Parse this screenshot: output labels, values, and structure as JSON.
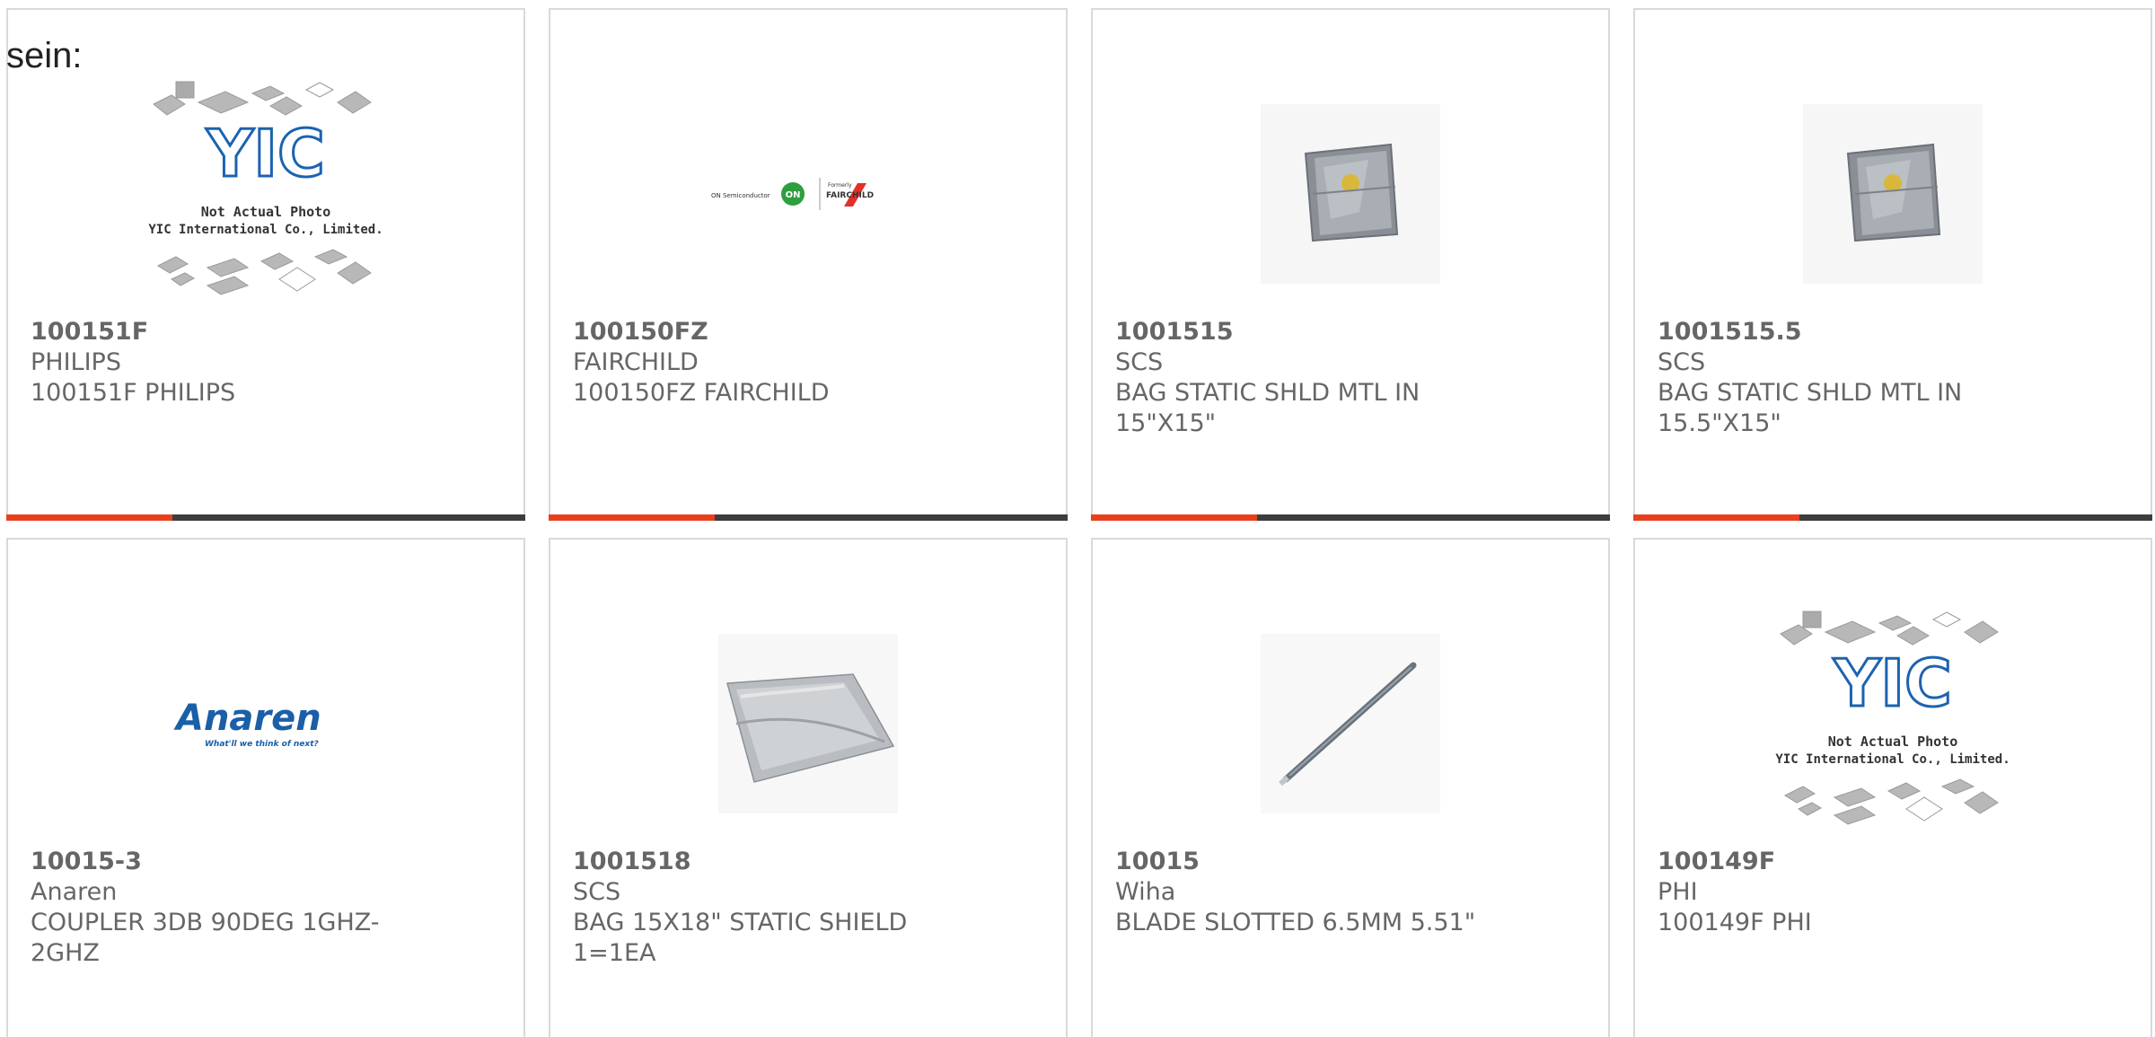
{
  "prefix_text": "sein:",
  "colors": {
    "text": "#666666",
    "border": "#d9d9d9",
    "bar": "#3d3d3d",
    "bar_accent": "#e8401c"
  },
  "products": [
    {
      "part_number": "100151F",
      "manufacturer": "PHILIPS",
      "description": "100151F PHILIPS",
      "image": "yic-placeholder-image",
      "image_text": {
        "line1": "Not Actual Photo",
        "line2": "YIC International Co., Limited.",
        "logo": "YIC"
      }
    },
    {
      "part_number": "100150FZ",
      "manufacturer": "FAIRCHILD",
      "description": "100150FZ FAIRCHILD",
      "image": "on-semiconductor-fairchild-logo",
      "image_text": {
        "left": "ON Semiconductor",
        "badge": "ON",
        "formerly": "Formerly",
        "brand": "FAIRCHILD"
      }
    },
    {
      "part_number": "1001515",
      "manufacturer": "SCS",
      "description": "BAG STATIC SHLD MTL IN 15\"X15\"",
      "image": "static-shield-bag-photo"
    },
    {
      "part_number": "1001515.5",
      "manufacturer": "SCS",
      "description": "BAG STATIC SHLD MTL IN 15.5\"X15\"",
      "image": "static-shield-bag-photo"
    },
    {
      "part_number": "10015-3",
      "manufacturer": "Anaren",
      "description": "COUPLER 3DB 90DEG 1GHZ-2GHZ",
      "image": "anaren-logo",
      "image_text": {
        "brand": "Anaren",
        "tagline": "What'll we think of next?"
      }
    },
    {
      "part_number": "1001518",
      "manufacturer": "SCS",
      "description": "BAG 15X18\" STATIC SHIELD 1=1EA",
      "image": "flat-shield-bag-photo"
    },
    {
      "part_number": "10015",
      "manufacturer": "Wiha",
      "description": "BLADE SLOTTED 6.5MM 5.51\"",
      "image": "screwdriver-blade-photo"
    },
    {
      "part_number": "100149F",
      "manufacturer": "PHI",
      "description": "100149F PHI",
      "image": "yic-placeholder-image",
      "image_text": {
        "line1": "Not Actual Photo",
        "line2": "YIC International Co., Limited.",
        "logo": "YIC"
      }
    }
  ]
}
